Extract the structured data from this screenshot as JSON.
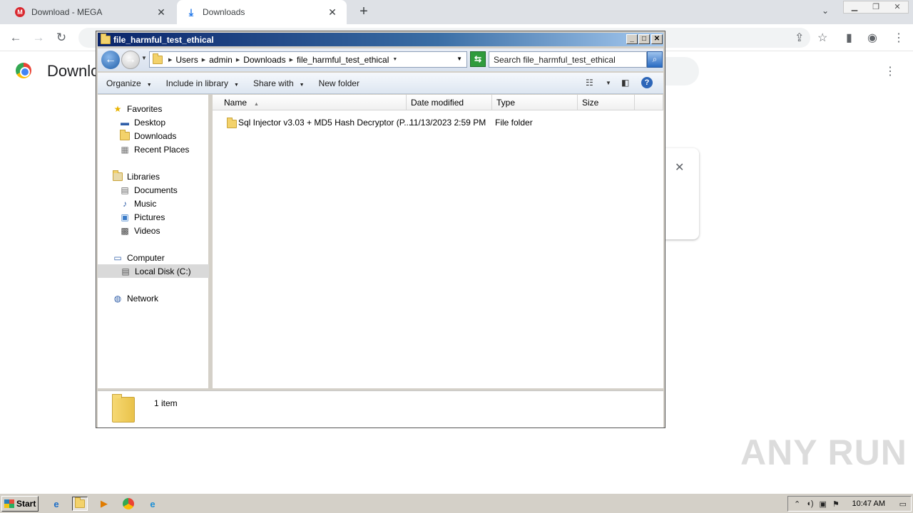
{
  "browser": {
    "tabs": [
      {
        "label": "Download - MEGA",
        "icon": "mega-icon"
      },
      {
        "label": "Downloads",
        "icon": "download-icon"
      }
    ],
    "page_title": "Downlo",
    "watermark": "ANY RUN"
  },
  "explorer": {
    "window_title": "file_harmful_test_ethical",
    "breadcrumbs": [
      "Users",
      "admin",
      "Downloads",
      "file_harmful_test_ethical"
    ],
    "search_placeholder": "Search file_harmful_test_ethical",
    "commands": {
      "organize": "Organize",
      "include_in_library": "Include in library",
      "share_with": "Share with",
      "new_folder": "New folder"
    },
    "nav": {
      "favorites": "Favorites",
      "desktop": "Desktop",
      "downloads": "Downloads",
      "recent_places": "Recent Places",
      "libraries": "Libraries",
      "documents": "Documents",
      "music": "Music",
      "pictures": "Pictures",
      "videos": "Videos",
      "computer": "Computer",
      "local_disk": "Local Disk (C:)",
      "network": "Network"
    },
    "columns": {
      "name": "Name",
      "date_modified": "Date modified",
      "type": "Type",
      "size": "Size"
    },
    "files": [
      {
        "name": "Sql Injector v3.03 + MD5 Hash Decryptor (P...",
        "date_modified": "11/13/2023 2:59 PM",
        "type": "File folder",
        "size": ""
      }
    ],
    "item_count": "1 item"
  },
  "taskbar": {
    "start_label": "Start",
    "clock": "10:47 AM"
  },
  "colors": {
    "title_bar_start": "#0a246a",
    "title_bar_end": "#a6caf0",
    "chrome_tab_bg": "#dee1e6",
    "taskbar_bg": "#d4d0c8"
  }
}
